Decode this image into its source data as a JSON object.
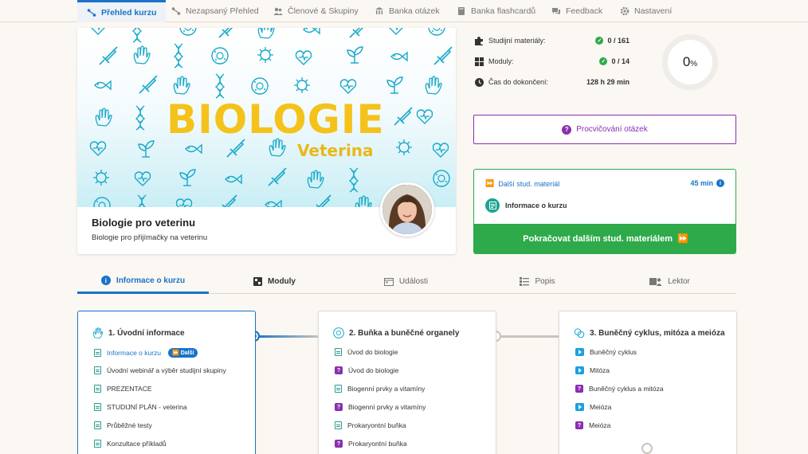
{
  "topnav": {
    "tabs": [
      {
        "label": "Přehled kurzu",
        "active": true
      },
      {
        "label": "Nezapsaný Přehled"
      },
      {
        "label": "Členové & Skupiny"
      },
      {
        "label": "Banka otázek"
      },
      {
        "label": "Banka flashcardů"
      },
      {
        "label": "Feedback"
      },
      {
        "label": "Nastavení"
      }
    ]
  },
  "course": {
    "banner_title": "BIOLOGIE",
    "banner_subtitle": "Veterina",
    "name": "Biologie pro veterinu",
    "subtitle": "Biologie pro přijímačky na veterinu"
  },
  "stats": {
    "materials_label": "Studijní materiály:",
    "materials_value": "0 / 161",
    "modules_label": "Moduly:",
    "modules_value": "0 / 14",
    "time_label": "Čas do dokončení:",
    "time_value": "128 h 29 min",
    "progress_value": "0",
    "progress_unit": "%"
  },
  "practice_button": "Procvičování otázek",
  "next": {
    "heading": "Další stud. materiál",
    "time": "45 min",
    "item": "Informace o kurzu",
    "continue_label": "Pokračovat dalším stud. materiálem"
  },
  "section_tabs": [
    {
      "label": "Informace o kurzu",
      "active": true
    },
    {
      "label": "Moduly"
    },
    {
      "label": "Události"
    },
    {
      "label": "Popis"
    },
    {
      "label": "Lektor"
    }
  ],
  "modules": [
    {
      "title": "1. Úvodní informace",
      "items": [
        {
          "label": "Informace o kurzu",
          "type": "doc",
          "next_badge": "Další"
        },
        {
          "label": "Úvodní webinář a výběr studijní skupiny",
          "type": "doc"
        },
        {
          "label": "PREZENTACE",
          "type": "doc"
        },
        {
          "label": "STUDIJNÍ PLÁN - veterina",
          "type": "doc"
        },
        {
          "label": "Průběžné testy",
          "type": "doc"
        },
        {
          "label": "Konzultace příkladů",
          "type": "doc"
        }
      ]
    },
    {
      "title": "2. Buňka a buněčné organely",
      "items": [
        {
          "label": "Úvod do biologie",
          "type": "doc"
        },
        {
          "label": "Úvod do biologie",
          "type": "quiz"
        },
        {
          "label": "Biogenní prvky a vitamíny",
          "type": "doc"
        },
        {
          "label": "Biogenní prvky a vitamíny",
          "type": "quiz"
        },
        {
          "label": "Prokaryontní buňka",
          "type": "doc"
        },
        {
          "label": "Prokaryontní buňka",
          "type": "quiz"
        }
      ]
    },
    {
      "title": "3. Buněčný cyklus, mitóza a meióza",
      "items": [
        {
          "label": "Buněčný cyklus",
          "type": "video"
        },
        {
          "label": "Mitóza",
          "type": "video"
        },
        {
          "label": "Buněčný cyklus a mitóza",
          "type": "quiz"
        },
        {
          "label": "Meióza",
          "type": "video"
        },
        {
          "label": "Meióza",
          "type": "quiz"
        }
      ]
    }
  ],
  "colors": {
    "accent": "#1a73c9",
    "success": "#2eaa4a",
    "practice": "#8a2fb0",
    "banner_title": "#f4c21a",
    "banner_icons": "#1aa9c9"
  }
}
